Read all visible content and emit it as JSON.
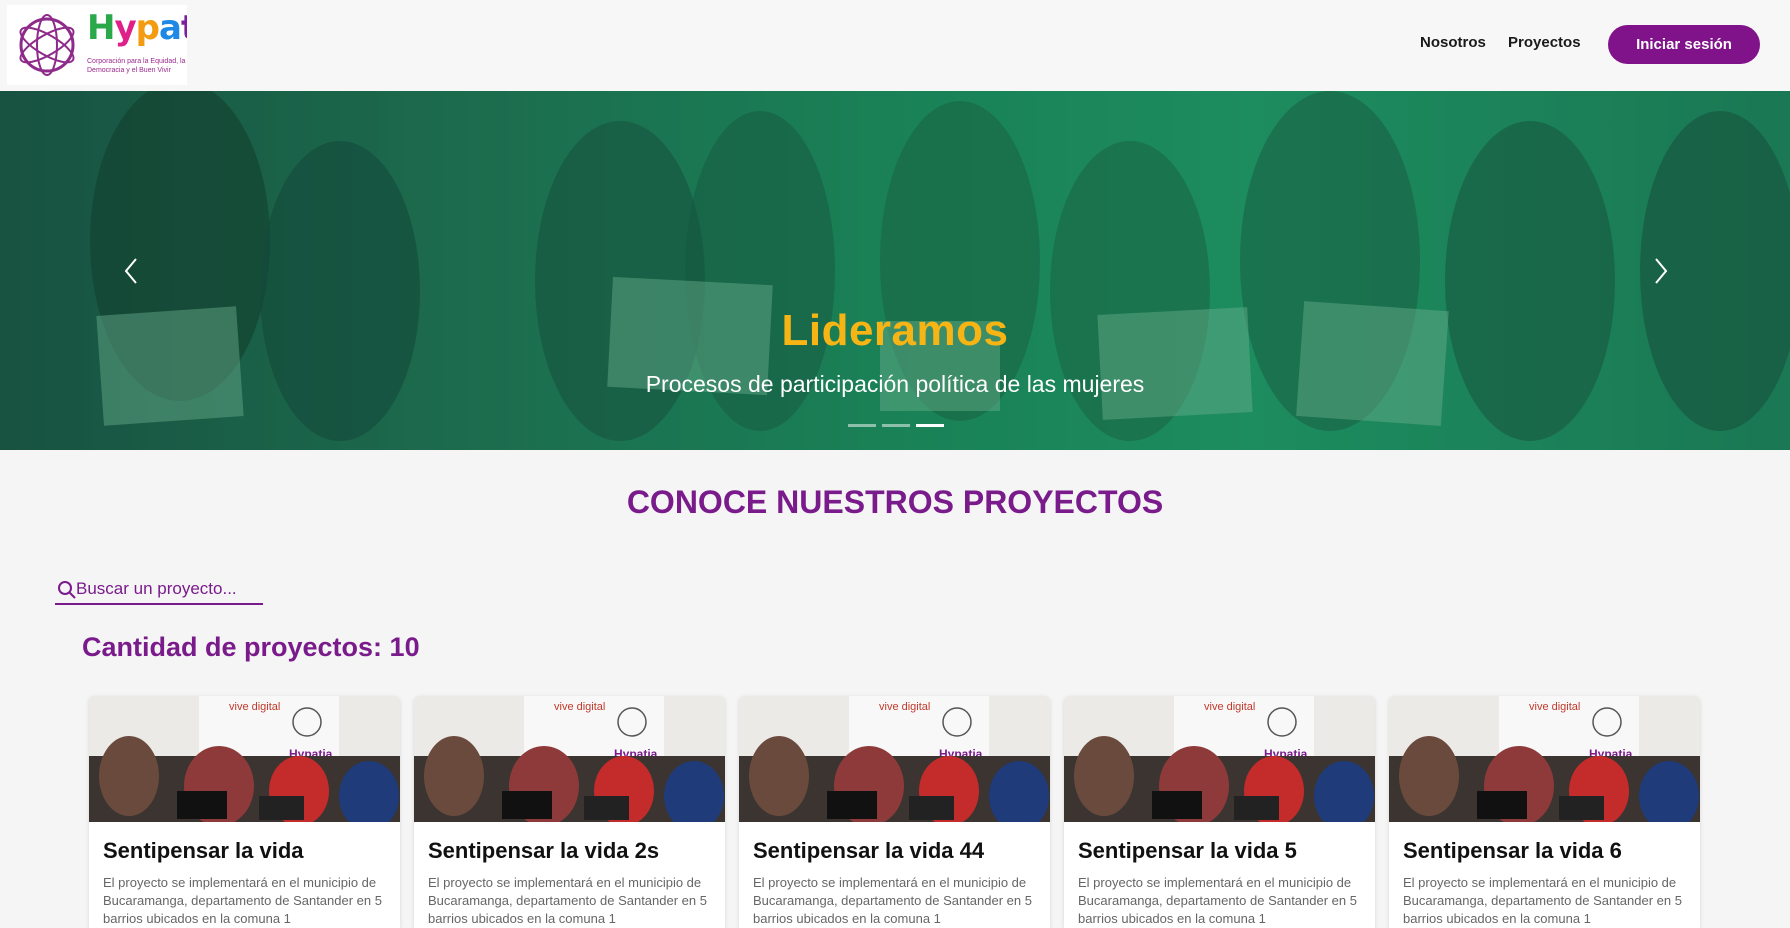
{
  "nav": {
    "logo_word": [
      "H",
      "y",
      "p",
      "a",
      "tia"
    ],
    "logo_tagline": "Corporación para la Equidad, la Democracia y el Buen Vivir",
    "links": [
      "Nosotros",
      "Proyectos"
    ],
    "login_label": "Iniciar sesión"
  },
  "hero": {
    "title": "Lideramos",
    "subtitle": "Procesos de participación política de las mujeres",
    "active_slide": 3,
    "slide_count": 3
  },
  "main": {
    "section_title": "CONOCE NUESTROS PROYECTOS",
    "search_placeholder": "Buscar un proyecto...",
    "count_label": "Cantidad de proyectos: 10"
  },
  "projects": [
    {
      "title": "Sentipensar la vida",
      "description": "El proyecto se implementará en el municipio de Bucaramanga, departamento de Santander en 5 barrios ubicados en la comuna 1"
    },
    {
      "title": "Sentipensar la vida 2s",
      "description": "El proyecto se implementará en el municipio de Bucaramanga, departamento de Santander en 5 barrios ubicados en la comuna 1"
    },
    {
      "title": "Sentipensar la vida 44",
      "description": "El proyecto se implementará en el municipio de Bucaramanga, departamento de Santander en 5 barrios ubicados en la comuna 1"
    },
    {
      "title": "Sentipensar la vida 5",
      "description": "El proyecto se implementará en el municipio de Bucaramanga, departamento de Santander en 5 barrios ubicados en la comuna 1"
    },
    {
      "title": "Sentipensar la vida 6",
      "description": "El proyecto se implementará en el municipio de Bucaramanga, departamento de Santander en 5 barrios ubicados en la comuna 1"
    }
  ],
  "card_image_text": {
    "banner_line": "vive digital",
    "logo_text": "Hypatia"
  },
  "colors": {
    "brand_purple": "#80138a",
    "heading_purple": "#7a1b8c",
    "hero_green": "#1a8a5a",
    "hero_title_gold": "#f7b515"
  },
  "icons": {
    "search": "search-icon",
    "prev": "chevron-left-icon",
    "next": "chevron-right-icon",
    "logo": "hypatia-logo"
  }
}
